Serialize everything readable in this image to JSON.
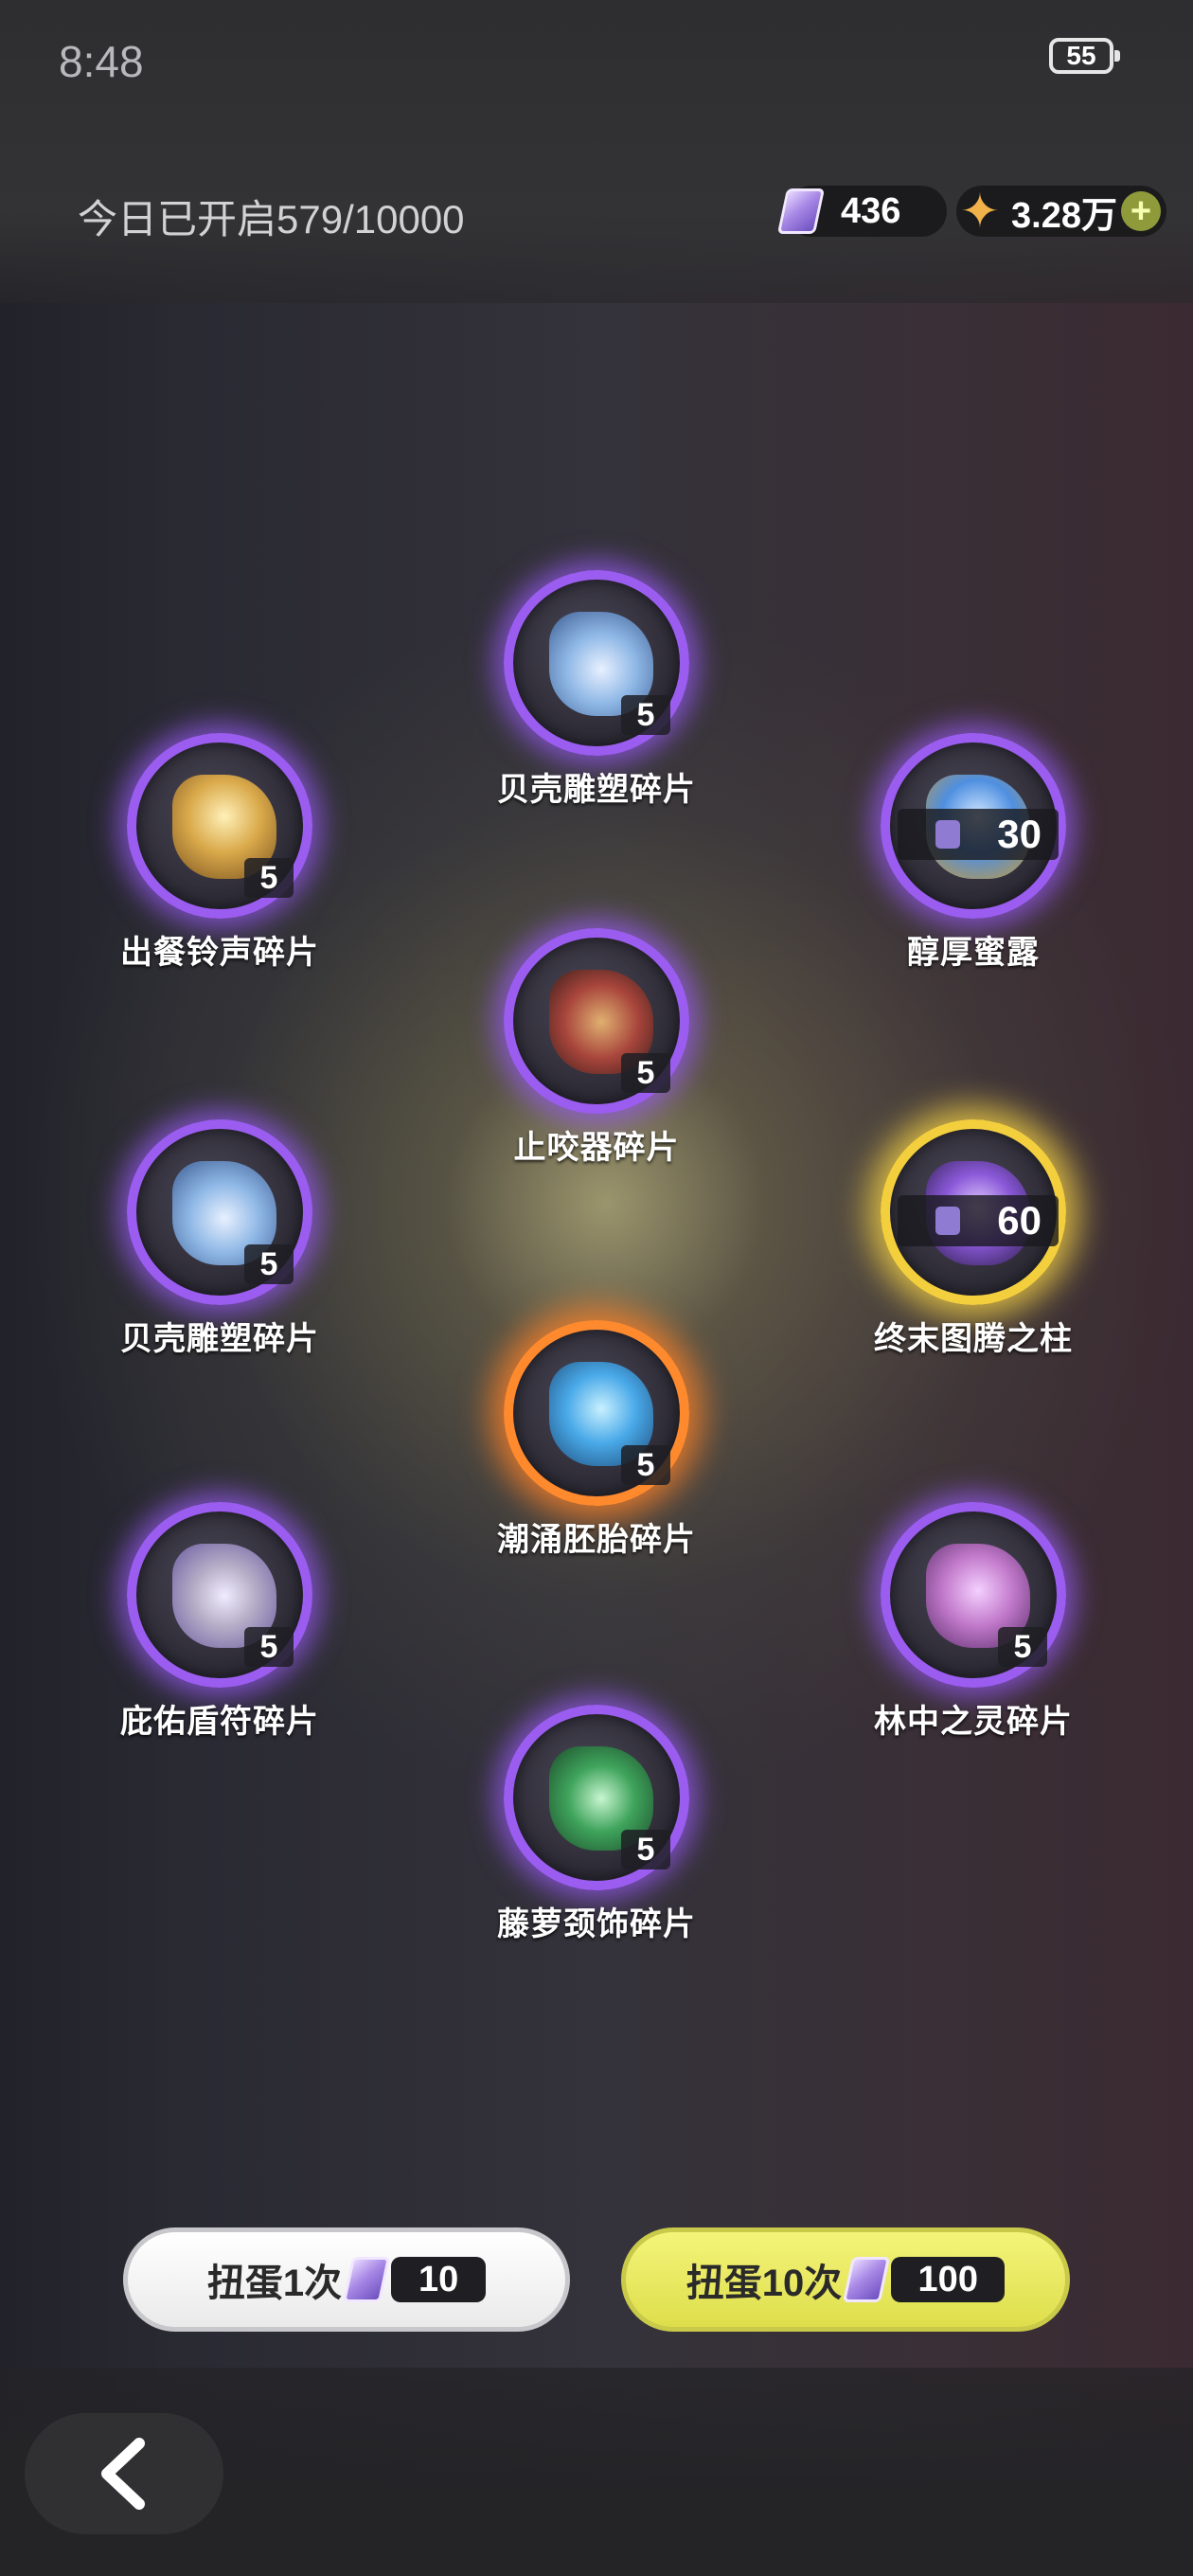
{
  "status_bar": {
    "time": "8:48",
    "battery": "55"
  },
  "header": {
    "today_opened": "今日已开启579/10000",
    "ticket_count": "436",
    "star_currency": "3.28万",
    "plus_icon": "plus-icon"
  },
  "prizes": [
    {
      "name": "贝壳雕塑碎片",
      "count": "5",
      "rarity": "purple",
      "icon": "shell-sculpture-icon",
      "color": "#8fb8e6"
    },
    {
      "name": "出餐铃声碎片",
      "count": "5",
      "rarity": "purple",
      "icon": "service-bell-icon",
      "color": "#d9a94a"
    },
    {
      "name": "醇厚蜜露",
      "count": "30",
      "rarity": "purple",
      "icon": "honey-nectar-icon",
      "color": "#4f8fe0"
    },
    {
      "name": "止咬器碎片",
      "count": "5",
      "rarity": "purple",
      "icon": "muzzle-icon",
      "color": "#a8453c"
    },
    {
      "name": "贝壳雕塑碎片",
      "count": "5",
      "rarity": "purple",
      "icon": "shell-sculpture-icon",
      "color": "#8fb8e6"
    },
    {
      "name": "终末图腾之柱",
      "count": "60",
      "rarity": "gold",
      "icon": "totem-pillar-icon",
      "color": "#8a58d8"
    },
    {
      "name": "潮涌胚胎碎片",
      "count": "5",
      "rarity": "orange",
      "icon": "tide-embryo-icon",
      "color": "#49a9e8"
    },
    {
      "name": "庇佑盾符碎片",
      "count": "5",
      "rarity": "purple",
      "icon": "shield-charm-icon",
      "color": "#b8b0c8"
    },
    {
      "name": "林中之灵碎片",
      "count": "5",
      "rarity": "purple",
      "icon": "forest-spirit-icon",
      "color": "#c27acb"
    },
    {
      "name": "藤萝颈饰碎片",
      "count": "5",
      "rarity": "purple",
      "icon": "vine-necklace-icon",
      "color": "#3fa45c"
    }
  ],
  "actions": {
    "single_label": "扭蛋1次",
    "single_cost": "10",
    "ten_label": "扭蛋10次",
    "ten_cost": "100"
  },
  "nav": {
    "back_icon": "back-chevron-icon"
  },
  "colors": {
    "accent_yellow": "#e6e65a",
    "purple_rarity": "#9b5cf0",
    "gold_rarity": "#f3cf3d",
    "orange_rarity": "#ff8a2e"
  }
}
